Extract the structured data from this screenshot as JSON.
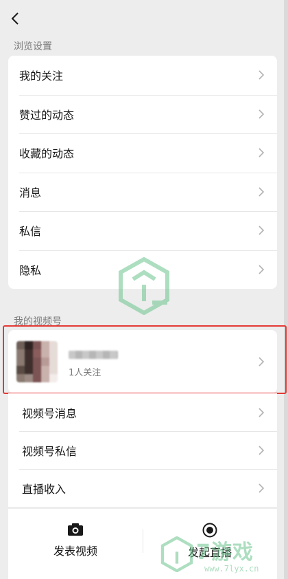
{
  "browse_settings": {
    "title": "浏览设置",
    "items": [
      {
        "label": "我的关注"
      },
      {
        "label": "赞过的动态"
      },
      {
        "label": "收藏的动态"
      },
      {
        "label": "消息"
      },
      {
        "label": "私信"
      },
      {
        "label": "隐私"
      }
    ]
  },
  "my_channel": {
    "title": "我的视频号",
    "profile": {
      "followers": "1人关注"
    },
    "items": [
      {
        "label": "视频号消息"
      },
      {
        "label": "视频号私信"
      },
      {
        "label": "直播收入"
      }
    ]
  },
  "bottom_actions": {
    "publish": {
      "label": "发表视频",
      "icon": "camera-icon"
    },
    "live": {
      "label": "发起直播",
      "icon": "live-record-icon"
    }
  },
  "watermark": {
    "brand_text": "7游戏",
    "url": "www.7lyx.cn"
  },
  "colors": {
    "background": "#EDEDED",
    "card": "#FFFFFF",
    "highlight": "#E53935",
    "watermark": "#6BC48E"
  }
}
